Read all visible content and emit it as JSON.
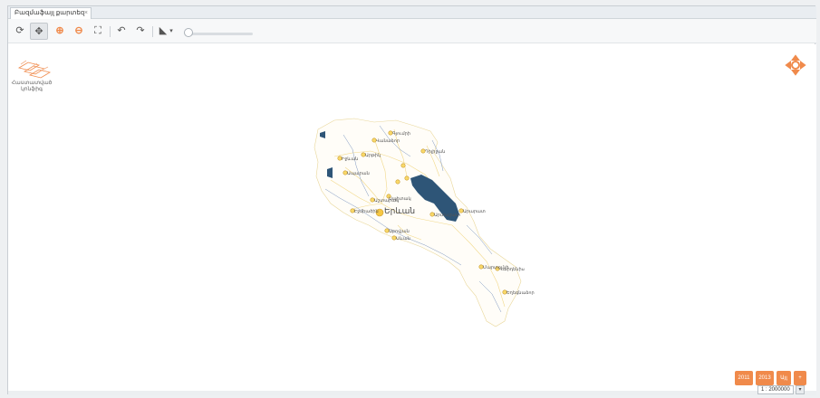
{
  "tab": {
    "title": "Բազմաֆայլ քարտեզ",
    "close": "×"
  },
  "toolbar": {
    "refresh": "⟳",
    "pan": "✥",
    "zoom_in": "⊕",
    "zoom_out": "⊖",
    "full_extent": "⛶",
    "undo": "↶",
    "redo": "↷",
    "measure": "◣",
    "measure_drop": "▾"
  },
  "legend": {
    "label": "Հաստատված կոնֆիգ"
  },
  "map": {
    "capital": "Երևան",
    "cities": [
      "Գյումրի",
      "Վանաձոր",
      "Դիլիջան",
      "Իջևան",
      "Արթիկ",
      "Ապարան",
      "Սպիտակ",
      "Աշտարակ",
      "Էջմիածին",
      "Աբովյան",
      "Սևան",
      "Արտաշատ",
      "Արարատ",
      "Մարտունի",
      "Վարդենիս",
      "Եղեգնաձոր",
      "Սիսիան",
      "Գորիս",
      "Կապան"
    ],
    "colors": {
      "lake": "#2e5577",
      "river": "#7d96c0",
      "road": "#f2d98a",
      "city": "#e8b33a"
    }
  },
  "zoom_buttons": [
    "2011",
    "2013",
    "Այլ",
    "+"
  ],
  "scale": {
    "value": "1 : 2000000",
    "dropdown": "▾"
  }
}
